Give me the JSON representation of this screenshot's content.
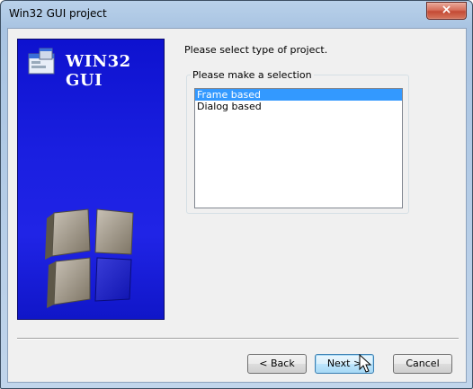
{
  "window": {
    "title": "Win32 GUI project",
    "close_glyph": "×"
  },
  "banner": {
    "title": "WIN32 GUI"
  },
  "main": {
    "prompt": "Please select type of project.",
    "group_label": "Please make a selection",
    "options": [
      {
        "label": "Frame based",
        "selected": true
      },
      {
        "label": "Dialog based",
        "selected": false
      }
    ]
  },
  "buttons": {
    "back": "< Back",
    "next": "Next >",
    "cancel": "Cancel"
  },
  "colors": {
    "banner_blue": "#1a1fe0",
    "selection": "#3399ff"
  }
}
